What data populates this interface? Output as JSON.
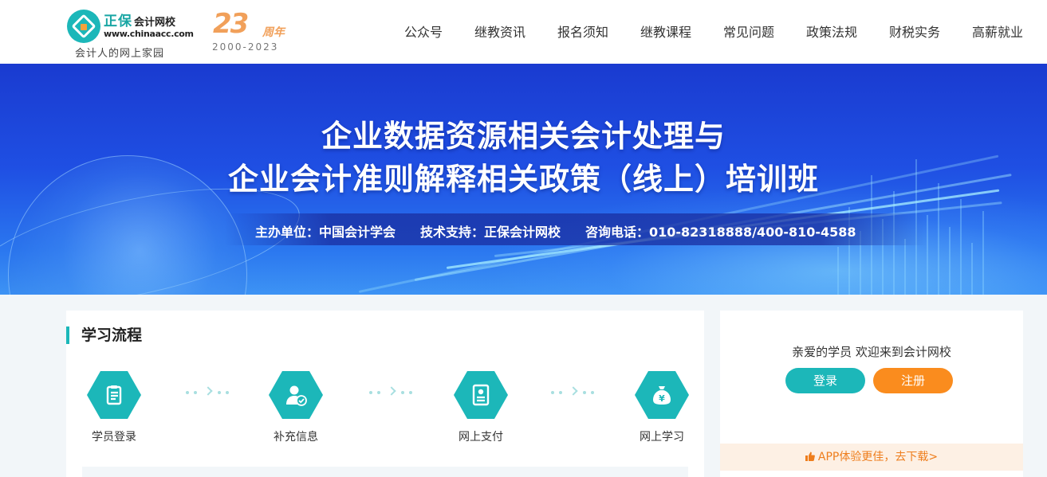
{
  "header": {
    "logo": {
      "brand": "正保",
      "brand_sub": "会计网校",
      "domain": "www.chinaacc.com",
      "slogan": "会计人的网上家园"
    },
    "anniversary": {
      "number": "23",
      "unit": "周年",
      "years": "2000-2023"
    },
    "nav": [
      {
        "label": "公众号"
      },
      {
        "label": "继教资讯"
      },
      {
        "label": "报名须知"
      },
      {
        "label": "继教课程"
      },
      {
        "label": "常见问题"
      },
      {
        "label": "政策法规"
      },
      {
        "label": "财税实务"
      },
      {
        "label": "高薪就业"
      }
    ]
  },
  "banner": {
    "title_line1": "企业数据资源相关会计处理与",
    "title_line2": "企业会计准则解释相关政策（线上）培训班",
    "organizer": "主办单位：中国会计学会",
    "tech_support": "技术支持：正保会计网校",
    "hotline": "咨询电话：010-82318888/400-810-4588"
  },
  "process": {
    "title": "学习流程",
    "steps": [
      {
        "label": "学员登录",
        "icon": "clipboard-icon"
      },
      {
        "label": "补充信息",
        "icon": "user-check-icon"
      },
      {
        "label": "网上支付",
        "icon": "payment-doc-icon"
      },
      {
        "label": "网上学习",
        "icon": "money-bag-icon"
      }
    ]
  },
  "account": {
    "welcome": "亲爱的学员 欢迎来到会计网校",
    "login_label": "登录",
    "register_label": "注册",
    "app_promo": "APP体验更佳，去下载>"
  },
  "colors": {
    "accent": "#1cb7b9",
    "orange": "#fa8c1e",
    "banner_blue": "#1f4fe3"
  }
}
